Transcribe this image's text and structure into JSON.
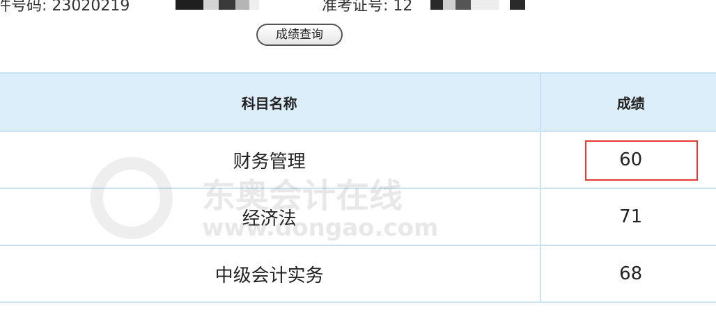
{
  "header": {
    "id_label": "件号码: 23020219",
    "ticket_label": "准考证号: 12"
  },
  "query_button": {
    "label": "成绩查询"
  },
  "table": {
    "columns": [
      "科目名称",
      "成绩"
    ],
    "rows": [
      {
        "subject": "财务管理",
        "score": "60"
      },
      {
        "subject": "经济法",
        "score": "71"
      },
      {
        "subject": "中级会计实务",
        "score": "68"
      }
    ]
  },
  "watermark": {
    "brand": "东奥会计在线",
    "url": "www.dongao.com"
  },
  "colors": {
    "header_bg": "#dceef9",
    "border": "#c8e2f1",
    "highlight": "#e53935"
  }
}
